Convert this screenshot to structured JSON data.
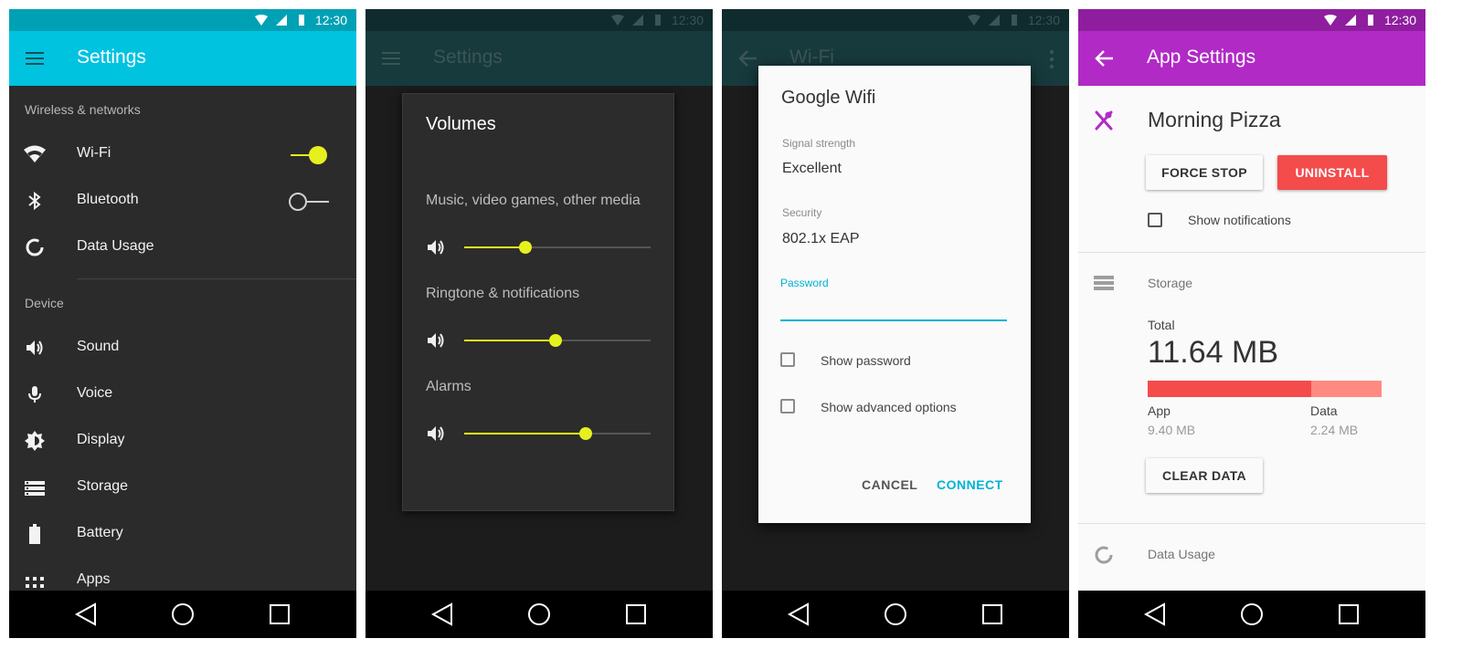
{
  "status": {
    "time": "12:30"
  },
  "phone1": {
    "title": "Settings",
    "section_wireless": "Wireless & networks",
    "wifi": {
      "label": "Wi-Fi",
      "enabled": true
    },
    "bluetooth": {
      "label": "Bluetooth",
      "enabled": false
    },
    "data_usage": "Data Usage",
    "section_device": "Device",
    "items": [
      "Sound",
      "Voice",
      "Display",
      "Storage",
      "Battery",
      "Apps"
    ],
    "accent": "#e6f01e",
    "appbar_color": "#00c3e0"
  },
  "phone2": {
    "title": "Settings",
    "dialog_title": "Volumes",
    "sliders": [
      {
        "label": "Music, video games, other media",
        "level": 0.33
      },
      {
        "label": "Ringtone & notifications",
        "level": 0.49
      },
      {
        "label": "Alarms",
        "level": 0.65
      }
    ]
  },
  "phone3": {
    "title": "Wi-Fi",
    "dialog_title": "Google Wifi",
    "signal_label": "Signal strength",
    "signal_value": "Excellent",
    "security_label": "Security",
    "security_value": "802.1x EAP",
    "password_label": "Password",
    "password_value": "",
    "show_password": "Show password",
    "show_advanced": "Show advanced options",
    "cancel": "CANCEL",
    "connect": "CONNECT",
    "accent": "#00b3d4"
  },
  "phone4": {
    "title": "App Settings",
    "app_name": "Morning Pizza",
    "force_stop": "FORCE STOP",
    "uninstall": "UNINSTALL",
    "show_notifications": "Show notifications",
    "storage_header": "Storage",
    "total_label": "Total",
    "total_value": "11.64 MB",
    "app_label": "App",
    "app_value": "9.40 MB",
    "data_label": "Data",
    "data_value": "2.24 MB",
    "app_fraction": 0.7,
    "clear_data": "CLEAR DATA",
    "data_usage_header": "Data Usage",
    "appbar_color": "#b12ac6",
    "accent": "#f44b4b"
  }
}
